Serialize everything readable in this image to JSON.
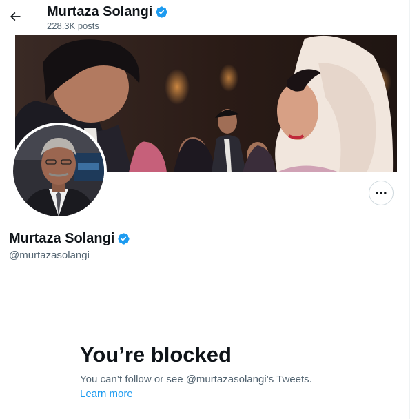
{
  "header": {
    "name": "Murtaza Solangi",
    "posts": "228.3K posts"
  },
  "profile": {
    "name": "Murtaza Solangi",
    "handle": "@murtazasolangi",
    "verified": true,
    "avatar": "profile-photo",
    "banner": "header-photo"
  },
  "blocked": {
    "title": "You’re blocked",
    "description": "You can’t follow or see @murtazasolangi’s Tweets.",
    "learn_more": "Learn more"
  },
  "icons": {
    "back": "arrow-left-icon",
    "verified": "verified-badge-icon",
    "more": "more-horizontal-icon"
  },
  "colors": {
    "accent": "#1d9bf0",
    "text": "#0f1419",
    "secondary_text": "#536471",
    "border": "#cfd9de"
  }
}
